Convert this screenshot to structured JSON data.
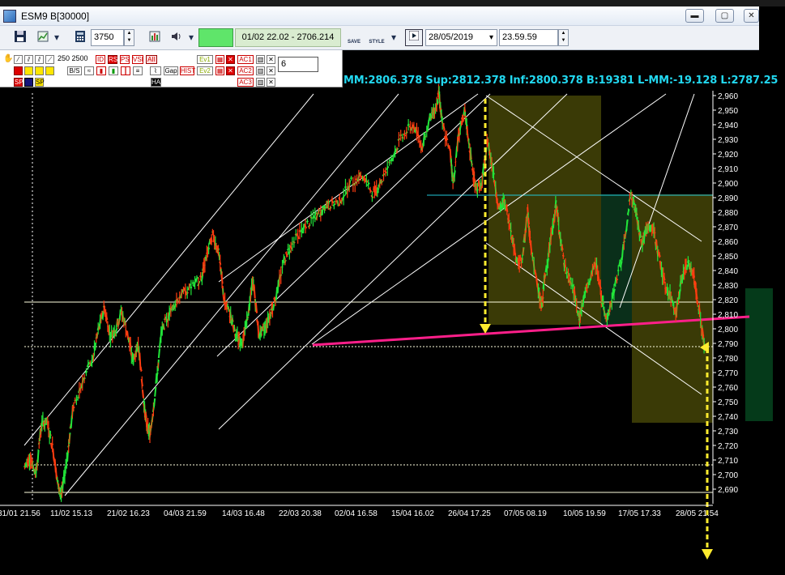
{
  "window": {
    "title": "ESM9 B[30000]",
    "buttons": {
      "minimize": "▬",
      "restore": "▢",
      "close": "✕"
    }
  },
  "toolbar": {
    "bars_value": "3750",
    "range_text": "01/02 22.02 - 2706.214",
    "save_label": "SAVE",
    "style_label": "STYLE",
    "date_value": "28/05/2019",
    "time_value": "23.59.59"
  },
  "indicators": {
    "row1_text": "250 2500",
    "row1_codes": [
      "ID",
      "RS",
      "PS",
      "VSI",
      "AII"
    ],
    "row2_codes": [
      "B/S",
      "HA",
      "Gap",
      "HIST"
    ],
    "event_labels": [
      "Ev1",
      "Ev2"
    ],
    "ac_labels": [
      "AC1",
      "AC2",
      "AC3"
    ],
    "hide_label": "HA",
    "sp_labels": [
      "SP",
      "SP"
    ],
    "count_value": "6"
  },
  "stats_text": "MM:2806.378 Sup:2812.378 Inf:2800.378 B:19381 L-MM:-19.128 L:2787.25",
  "chart_data": {
    "type": "line",
    "title": "",
    "ylim": [
      2680,
      2965
    ],
    "yticks": [
      "2,960",
      "2,950",
      "2,940",
      "2,930",
      "2,920",
      "2,910",
      "2,900",
      "2,890",
      "2,880",
      "2,870",
      "2,860",
      "2,850",
      "2,840",
      "2,830",
      "2,820",
      "2,810",
      "2,800",
      "2,790",
      "2,780",
      "2,770",
      "2,760",
      "2,750",
      "2,740",
      "2,730",
      "2,720",
      "2,710",
      "2,700",
      "2,690"
    ],
    "xticks": [
      "31/01 21.56",
      "11/02 15.13",
      "21/02 16.23",
      "04/03 21.59",
      "14/03 16.48",
      "22/03 20.38",
      "02/04 16.58",
      "15/04 16.02",
      "26/04 17.25",
      "07/05 08.19",
      "10/05 19.59",
      "17/05 17.33",
      "28/05 21.54"
    ],
    "price_path": [
      [
        0.0,
        2705
      ],
      [
        0.01,
        2712
      ],
      [
        0.02,
        2700
      ],
      [
        0.03,
        2735
      ],
      [
        0.04,
        2736
      ],
      [
        0.05,
        2718
      ],
      [
        0.06,
        2690
      ],
      [
        0.065,
        2686
      ],
      [
        0.075,
        2712
      ],
      [
        0.085,
        2745
      ],
      [
        0.1,
        2762
      ],
      [
        0.12,
        2780
      ],
      [
        0.13,
        2800
      ],
      [
        0.14,
        2815
      ],
      [
        0.15,
        2795
      ],
      [
        0.16,
        2800
      ],
      [
        0.17,
        2812
      ],
      [
        0.18,
        2797
      ],
      [
        0.19,
        2778
      ],
      [
        0.2,
        2790
      ],
      [
        0.21,
        2745
      ],
      [
        0.215,
        2732
      ],
      [
        0.22,
        2728
      ],
      [
        0.23,
        2760
      ],
      [
        0.24,
        2798
      ],
      [
        0.255,
        2812
      ],
      [
        0.27,
        2822
      ],
      [
        0.29,
        2828
      ],
      [
        0.31,
        2835
      ],
      [
        0.32,
        2852
      ],
      [
        0.33,
        2865
      ],
      [
        0.34,
        2852
      ],
      [
        0.35,
        2818
      ],
      [
        0.36,
        2810
      ],
      [
        0.37,
        2795
      ],
      [
        0.38,
        2790
      ],
      [
        0.39,
        2806
      ],
      [
        0.4,
        2834
      ],
      [
        0.41,
        2796
      ],
      [
        0.42,
        2800
      ],
      [
        0.43,
        2810
      ],
      [
        0.44,
        2822
      ],
      [
        0.455,
        2848
      ],
      [
        0.47,
        2860
      ],
      [
        0.49,
        2870
      ],
      [
        0.51,
        2877
      ],
      [
        0.53,
        2885
      ],
      [
        0.55,
        2887
      ],
      [
        0.57,
        2900
      ],
      [
        0.59,
        2905
      ],
      [
        0.61,
        2893
      ],
      [
        0.62,
        2898
      ],
      [
        0.64,
        2915
      ],
      [
        0.66,
        2932
      ],
      [
        0.68,
        2940
      ],
      [
        0.695,
        2925
      ],
      [
        0.71,
        2945
      ],
      [
        0.72,
        2952
      ],
      [
        0.725,
        2962
      ],
      [
        0.73,
        2942
      ],
      [
        0.745,
        2920
      ],
      [
        0.75,
        2900
      ],
      [
        0.76,
        2935
      ],
      [
        0.77,
        2948
      ],
      [
        0.775,
        2935
      ],
      [
        0.785,
        2905
      ],
      [
        0.79,
        2897
      ],
      [
        0.8,
        2898
      ],
      [
        0.81,
        2930
      ],
      [
        0.82,
        2908
      ],
      [
        0.83,
        2882
      ],
      [
        0.84,
        2887
      ],
      [
        0.85,
        2870
      ],
      [
        0.86,
        2848
      ],
      [
        0.87,
        2845
      ],
      [
        0.88,
        2880
      ],
      [
        0.885,
        2860
      ],
      [
        0.9,
        2822
      ],
      [
        0.905,
        2815
      ],
      [
        0.91,
        2835
      ],
      [
        0.92,
        2860
      ],
      [
        0.93,
        2885
      ],
      [
        0.935,
        2870
      ],
      [
        0.945,
        2842
      ],
      [
        0.96,
        2828
      ],
      [
        0.97,
        2806
      ],
      [
        0.975,
        2815
      ],
      [
        0.985,
        2830
      ],
      [
        1.0,
        2845
      ],
      [
        1.01,
        2820
      ],
      [
        1.02,
        2806
      ],
      [
        1.03,
        2825
      ],
      [
        1.045,
        2848
      ],
      [
        1.06,
        2892
      ],
      [
        1.07,
        2880
      ],
      [
        1.08,
        2858
      ],
      [
        1.09,
        2870
      ],
      [
        1.1,
        2868
      ],
      [
        1.11,
        2850
      ],
      [
        1.12,
        2830
      ],
      [
        1.13,
        2822
      ],
      [
        1.14,
        2812
      ],
      [
        1.15,
        2835
      ],
      [
        1.16,
        2845
      ],
      [
        1.17,
        2838
      ],
      [
        1.175,
        2825
      ],
      [
        1.185,
        2800
      ],
      [
        1.19,
        2786
      ]
    ]
  },
  "colors": {
    "background": "#000000",
    "rising": "#22e53a",
    "falling": "#ff3c10",
    "stats": "#22d8f0",
    "box": "#3a3a06",
    "support_line": "#ff1f8a",
    "signal_arrow": "#ffeb2e",
    "volume_box": "#0a3a1a"
  }
}
